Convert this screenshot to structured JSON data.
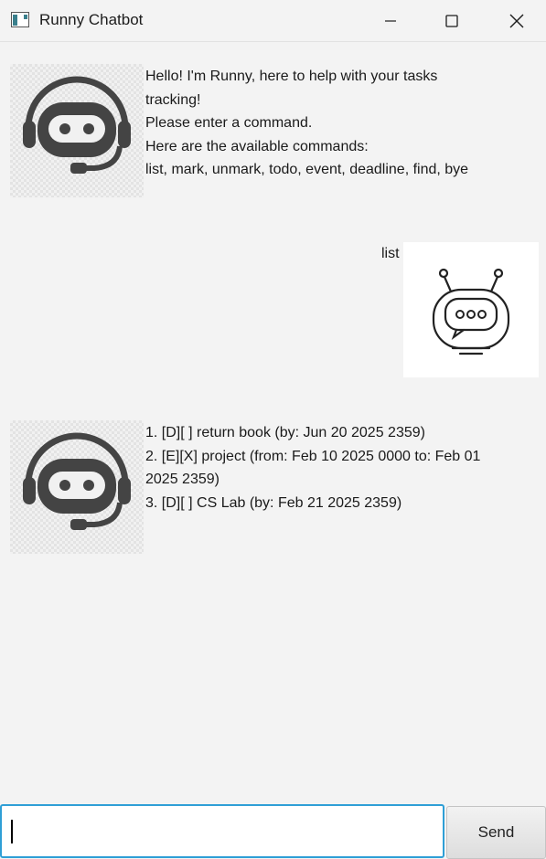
{
  "window": {
    "title": "Runny Chatbot"
  },
  "messages": [
    {
      "sender": "bot",
      "text": "Hello! I'm Runny, here to help with your tasks\ntracking!\nPlease enter a command.\nHere are the available commands:\nlist, mark, unmark, todo, event, deadline, find, bye"
    },
    {
      "sender": "user",
      "text": "list"
    },
    {
      "sender": "bot",
      "text": "1. [D][ ] return book  (by: Jun 20 2025 2359)\n2. [E][X] project  (from: Feb 10 2025 0000 to: Feb 01\n2025 2359)\n3. [D][ ] CS Lab  (by: Feb 21 2025 2359)"
    }
  ],
  "input": {
    "value": "",
    "placeholder": ""
  },
  "send_button": {
    "label": "Send"
  },
  "colors": {
    "accent": "#2f9fd6",
    "background": "#f3f3f3",
    "bot_icon": "#444444"
  },
  "icons": {
    "bot_avatar": "headset-robot-icon",
    "user_avatar": "robot-chat-icon",
    "app": "app-window-icon"
  }
}
